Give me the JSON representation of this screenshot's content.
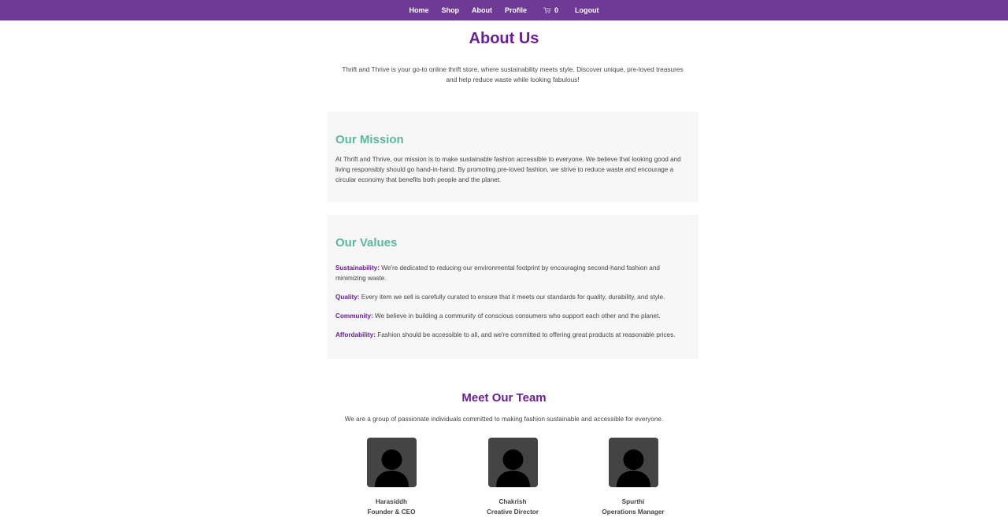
{
  "nav": {
    "home": "Home",
    "shop": "Shop",
    "about": "About",
    "profile": "Profile",
    "cart_count": "0",
    "logout": "Logout"
  },
  "page": {
    "title": "About Us",
    "intro": "Thrift and Thrive is your go-to online thrift store, where sustainability meets style. Discover unique, pre-loved treasures and help reduce waste while looking fabulous!"
  },
  "mission": {
    "heading": "Our Mission",
    "text": "At Thrift and Thrive, our mission is to make sustainable fashion accessible to everyone. We believe that looking good and living responsibly should go hand-in-hand. By promoting pre-loved fashion, we strive to reduce waste and encourage a circular economy that benefits both people and the planet."
  },
  "values": {
    "heading": "Our Values",
    "items": [
      {
        "label": "Sustainability:",
        "text": " We're dedicated to reducing our environmental footprint by encouraging second-hand fashion and minimizing waste."
      },
      {
        "label": "Quality:",
        "text": " Every item we sell is carefully curated to ensure that it meets our standards for quality, durability, and style."
      },
      {
        "label": "Community:",
        "text": " We believe in building a community of conscious consumers who support each other and the planet."
      },
      {
        "label": "Affordability:",
        "text": " Fashion should be accessible to all, and we're committed to offering great products at reasonable prices."
      }
    ]
  },
  "team": {
    "heading": "Meet Our Team",
    "subtitle": "We are a group of passionate individuals committed to making fashion sustainable and accessible for everyone.",
    "members": [
      {
        "name": "Harasiddh",
        "role": "Founder & CEO"
      },
      {
        "name": "Chakrish",
        "role": "Creative Director"
      },
      {
        "name": "Spurthi",
        "role": "Operations Manager"
      }
    ]
  },
  "colors": {
    "nav_bg": "#6f3a93",
    "title_purple": "#6a1f93",
    "heading_green": "#5cb896",
    "card_bg": "#f7f7f7"
  },
  "icons": {
    "cart": "shopping-cart-icon",
    "avatar": "user-silhouette-icon"
  }
}
